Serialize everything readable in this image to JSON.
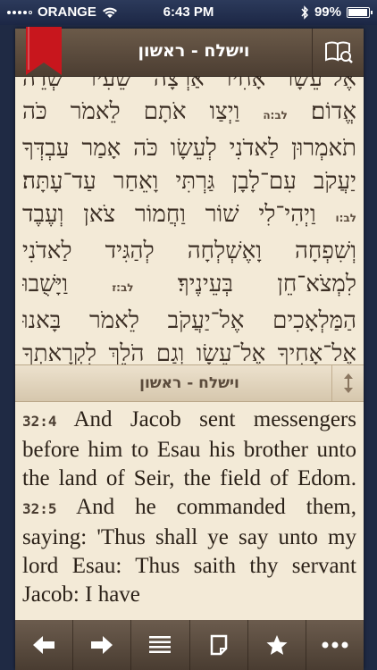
{
  "status": {
    "carrier": "ORANGE",
    "time": "6:43 PM",
    "battery": "99%",
    "battery_level": 0.99
  },
  "header": {
    "title": "וישלח - ראשון",
    "bookmark_color": "#c8161d"
  },
  "hebrew": {
    "lines": [
      "אֶל־עֵשָׂו אָחִיו אַרְצָה שֵׂעִיר שְׂדֵה",
      "אֱדוֹם׃ {vn} וַיְצַו אֹתָם לֵאמֹר כֹּה",
      "תֹאמְרוּן לַאדֹנִי לְעֵשָׂו כֹּה אָמַר עַבְדְּךָ",
      "יַעֲקֹב עִם־לָבָן גַּרְתִּי וָאֵחַר עַד־עָתָּה׃",
      "{vn} וַיְהִי־לִי שׁוֹר וַחֲמוֹר צֹאן וְעֶבֶד",
      "וְשִׁפְחָה וָאֶשְׁלְחָה לְהַגִּיד לַאדֹנִי",
      "לִמְצֹא־חֵן בְּעֵינֶיךָ׃ {vn} וַיָּשֻׁבוּ",
      "הַמַּלְאָכִים אֶל־יַעֲקֹב לֵאמֹר בָּאנוּ",
      "אֶל־אָחִיךָ אֶל־עֵשָׂו וְגַם הֹלֵךְ לִקְרָאתְךָ"
    ],
    "verse_nums": [
      "לב:ה",
      "לב:ו",
      "לב:ז"
    ]
  },
  "mid": {
    "title": "וישלח - ראשון"
  },
  "english": {
    "segments": [
      {
        "vn": "32:4",
        "text": " And Jacob sent messengers before him to Esau his brother unto the land of Seir, the field of Edom. "
      },
      {
        "vn": "32:5",
        "text": " And he commanded them, saying: 'Thus shall ye say unto my lord Esau: Thus saith thy servant Jacob: I have"
      }
    ]
  },
  "toolbar": {
    "icons": [
      "back-arrow-icon",
      "forward-arrow-icon",
      "list-icon",
      "page-icon",
      "star-icon",
      "more-icon"
    ]
  }
}
